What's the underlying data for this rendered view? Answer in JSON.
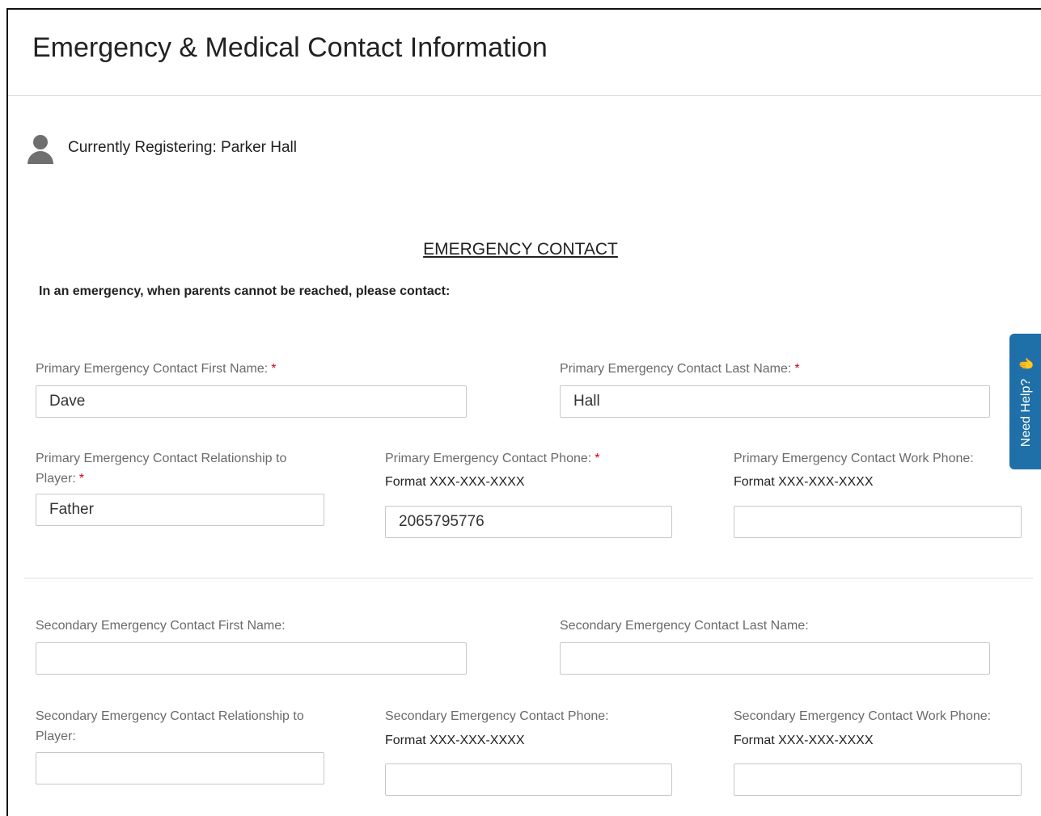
{
  "page": {
    "title": "Emergency & Medical Contact Information"
  },
  "registering": {
    "text": "Currently Registering: Parker Hall"
  },
  "emergency_section": {
    "heading": "EMERGENCY CONTACT",
    "instruction": "In an emergency, when parents cannot be reached, please contact:"
  },
  "required_marker": "*",
  "primary": {
    "first_name": {
      "label": "Primary Emergency Contact First Name:",
      "value": "Dave",
      "required": true
    },
    "last_name": {
      "label": "Primary Emergency Contact Last Name:",
      "value": "Hall",
      "required": true
    },
    "relationship": {
      "label": "Primary Emergency Contact Relationship to Player:",
      "value": "Father",
      "required": true
    },
    "phone": {
      "label": "Primary Emergency Contact Phone:",
      "format": "Format XXX-XXX-XXXX",
      "value": "2065795776",
      "required": true
    },
    "work_phone": {
      "label": "Primary Emergency Contact Work Phone:",
      "format": "Format XXX-XXX-XXXX",
      "value": "",
      "required": false
    }
  },
  "secondary": {
    "first_name": {
      "label": "Secondary Emergency Contact First Name:",
      "value": ""
    },
    "last_name": {
      "label": "Secondary Emergency Contact Last Name:",
      "value": ""
    },
    "relationship": {
      "label": "Secondary Emergency Contact Relationship to Player:",
      "value": ""
    },
    "phone": {
      "label": "Secondary Emergency Contact Phone:",
      "format": "Format XXX-XXX-XXXX",
      "value": ""
    },
    "work_phone": {
      "label": "Secondary Emergency Contact Work Phone:",
      "format": "Format XXX-XXX-XXXX",
      "value": ""
    }
  },
  "help_tab": {
    "label": "Need Help?",
    "icon": "waving-hand-icon",
    "icon_glyph": "✋"
  },
  "colors": {
    "required": "#d0021b",
    "help_tab": "#1f6fa8",
    "label_text": "#6a6a6a"
  }
}
